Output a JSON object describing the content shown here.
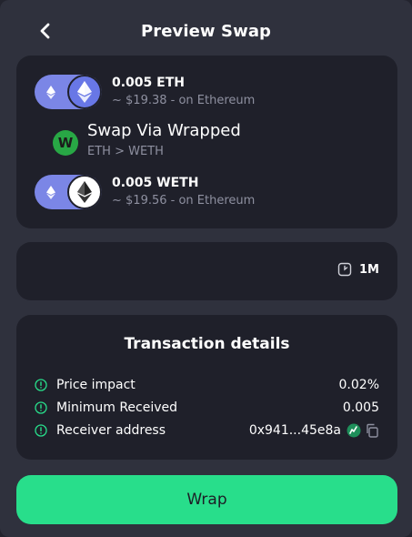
{
  "header": {
    "title": "Preview Swap"
  },
  "swap": {
    "from": {
      "amount": "0.005 ETH",
      "subtitle": "~ $19.38 - on Ethereum"
    },
    "via": {
      "badge": "W",
      "title": "Swap Via Wrapped",
      "path": "ETH > WETH"
    },
    "to": {
      "amount": "0.005 WETH",
      "subtitle": "~ $19.56 - on Ethereum"
    }
  },
  "time": {
    "estimate": "1M"
  },
  "details": {
    "title": "Transaction details",
    "rows": [
      {
        "label": "Price impact",
        "value": "0.02%"
      },
      {
        "label": "Minimum Received",
        "value": "0.005"
      },
      {
        "label": "Receiver address",
        "value": "0x941...45e8a"
      }
    ]
  },
  "action": {
    "label": "Wrap"
  },
  "colors": {
    "background": "#2f313d",
    "card": "#1f202a",
    "accent": "#28de8b",
    "eth_pill": "#7b86e6",
    "info_icon": "#28de8b",
    "muted_text": "#8e90a0"
  },
  "icons": {
    "back": "chevron-left-icon",
    "chain": "ethereum-icon",
    "via": "wrapped-badge-icon",
    "time": "clock-icon",
    "info": "info-circle-icon",
    "external": "explorer-icon",
    "copy": "copy-icon"
  }
}
